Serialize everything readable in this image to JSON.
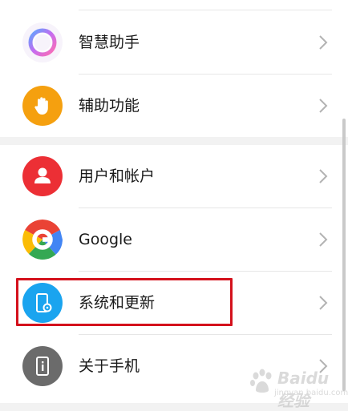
{
  "settings": {
    "items": [
      {
        "label": "智慧助手",
        "icon": "assistant-ring-icon"
      },
      {
        "label": "辅助功能",
        "icon": "hand-icon"
      },
      {
        "label": "用户和帐户",
        "icon": "user-icon"
      },
      {
        "label": "Google",
        "icon": "google-g-icon"
      },
      {
        "label": "系统和更新",
        "icon": "phone-settings-icon"
      },
      {
        "label": "关于手机",
        "icon": "phone-info-icon"
      }
    ]
  },
  "colors": {
    "accessibility": "#f5a00f",
    "users": "#ec2f35",
    "system": "#1aa4ef",
    "about": "#6b6b6b",
    "highlight": "#d4111c"
  },
  "watermark": {
    "text": "Baidu 经验",
    "sub": "jingyan.baidu.com"
  }
}
